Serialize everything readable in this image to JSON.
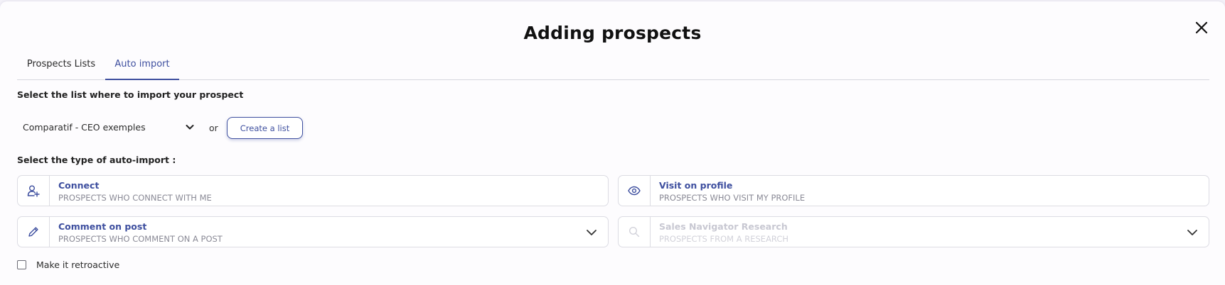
{
  "modal": {
    "title": "Adding prospects"
  },
  "tabs": [
    {
      "label": "Prospects Lists",
      "active": false
    },
    {
      "label": "Auto import",
      "active": true
    }
  ],
  "list_section": {
    "label": "Select the list where to import your prospect",
    "selected_list": "Comparatif - CEO exemples",
    "or_text": "or",
    "create_button": "Create a list"
  },
  "type_section": {
    "label": "Select the type of auto-import :",
    "options": [
      {
        "title": "Connect",
        "subtitle": "PROSPECTS WHO CONNECT WITH ME",
        "icon": "user-plus-icon",
        "enabled": true,
        "dropdown": false
      },
      {
        "title": "Visit on profile",
        "subtitle": "PROSPECTS WHO VISIT MY PROFILE",
        "icon": "eye-icon",
        "enabled": true,
        "dropdown": false
      },
      {
        "title": "Comment on post",
        "subtitle": "PROSPECTS WHO COMMENT ON A POST",
        "icon": "pencil-icon",
        "enabled": true,
        "dropdown": true
      },
      {
        "title": "Sales Navigator Research",
        "subtitle": "PROSPECTS FROM A RESEARCH",
        "icon": "search-icon",
        "enabled": false,
        "dropdown": true
      }
    ]
  },
  "retroactive": {
    "label": "Make it retroactive",
    "checked": false
  },
  "colors": {
    "accent": "#3e4f9f",
    "border": "#dcdce3",
    "subtitle": "#8a8a96",
    "disabled": "#c8c8d2"
  }
}
